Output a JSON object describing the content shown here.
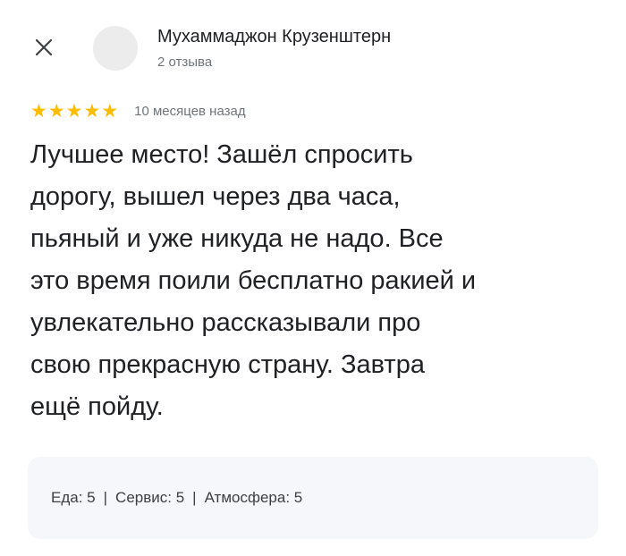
{
  "close_icon": "close-icon",
  "author": {
    "avatar_icon": "avatar-placeholder",
    "name": "Мухаммаджон Крузенштерн",
    "reviews_count": "2 отзыва"
  },
  "review": {
    "rating": 5,
    "rating_max": 5,
    "star_color": "#fbbc04",
    "date": "10 месяцев назад",
    "text": "Лучшее место! Зашёл спросить\nдорогу, вышел через два часа,\nпьяный и уже никуда не надо. Все\nэто время поили бесплатно ракией и\nувлекательно рассказывали про\nсвою прекрасную страну. Завтра\nещё пойду."
  },
  "attributes": {
    "food": "Еда: 5",
    "service": "Сервис: 5",
    "atmosphere": "Атмосфера: 5",
    "separator": "|"
  }
}
